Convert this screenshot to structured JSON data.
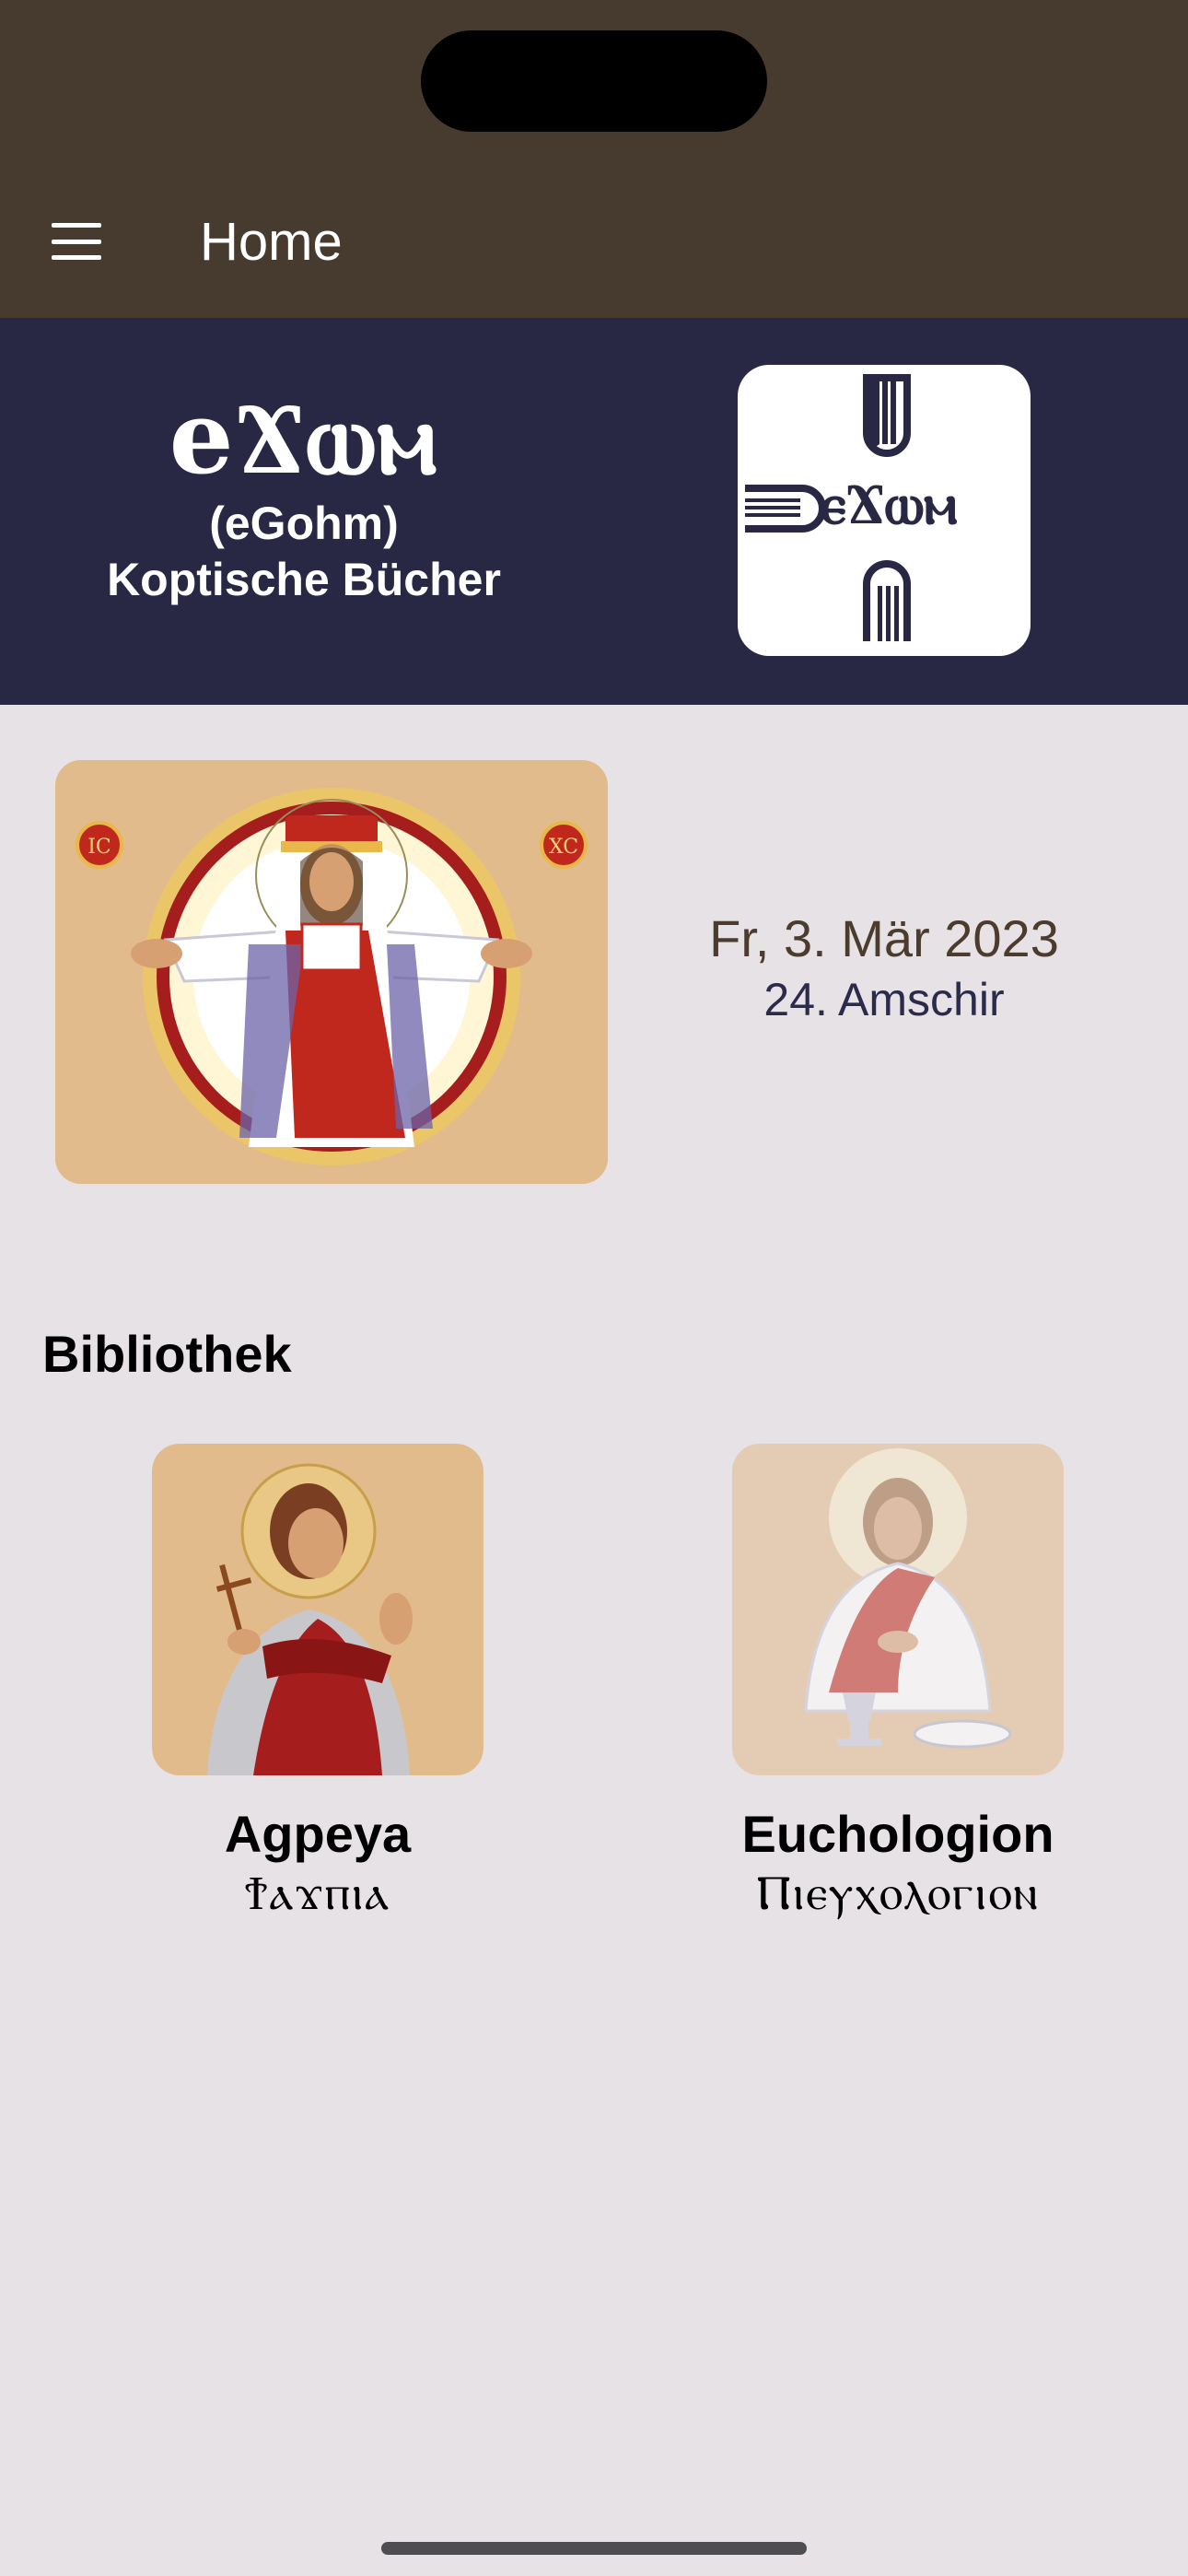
{
  "app_bar": {
    "title": "Home",
    "menu_icon": "hamburger-menu-icon",
    "background": "#473a2f"
  },
  "banner": {
    "coptic_name": "eϪⲱⲙ",
    "latin_name": "(eGohm)",
    "subtitle": "Koptische Bücher",
    "logo_text": "ⲉϪⲱⲙ",
    "background": "#282844"
  },
  "daily": {
    "image": "christ-icon",
    "gregorian_date": "Fr, 3. Mär 2023",
    "coptic_date": "24. Amschir"
  },
  "library": {
    "title": "Bibliothek",
    "books": [
      {
        "title": "Agpeya",
        "coptic_title": "Ϯⲁϫⲡⲓⲁ",
        "image": "saint-icon"
      },
      {
        "title": "Euchologion",
        "coptic_title": "Ⲡⲓⲉⲩⲭⲟⲗⲟⲅⲓⲟⲛ",
        "image": "christ-eucharist-icon"
      }
    ]
  },
  "colors": {
    "page_background": "#e7e2e5",
    "card_background": "#e2bb8d",
    "accent_red": "#c0281e"
  }
}
